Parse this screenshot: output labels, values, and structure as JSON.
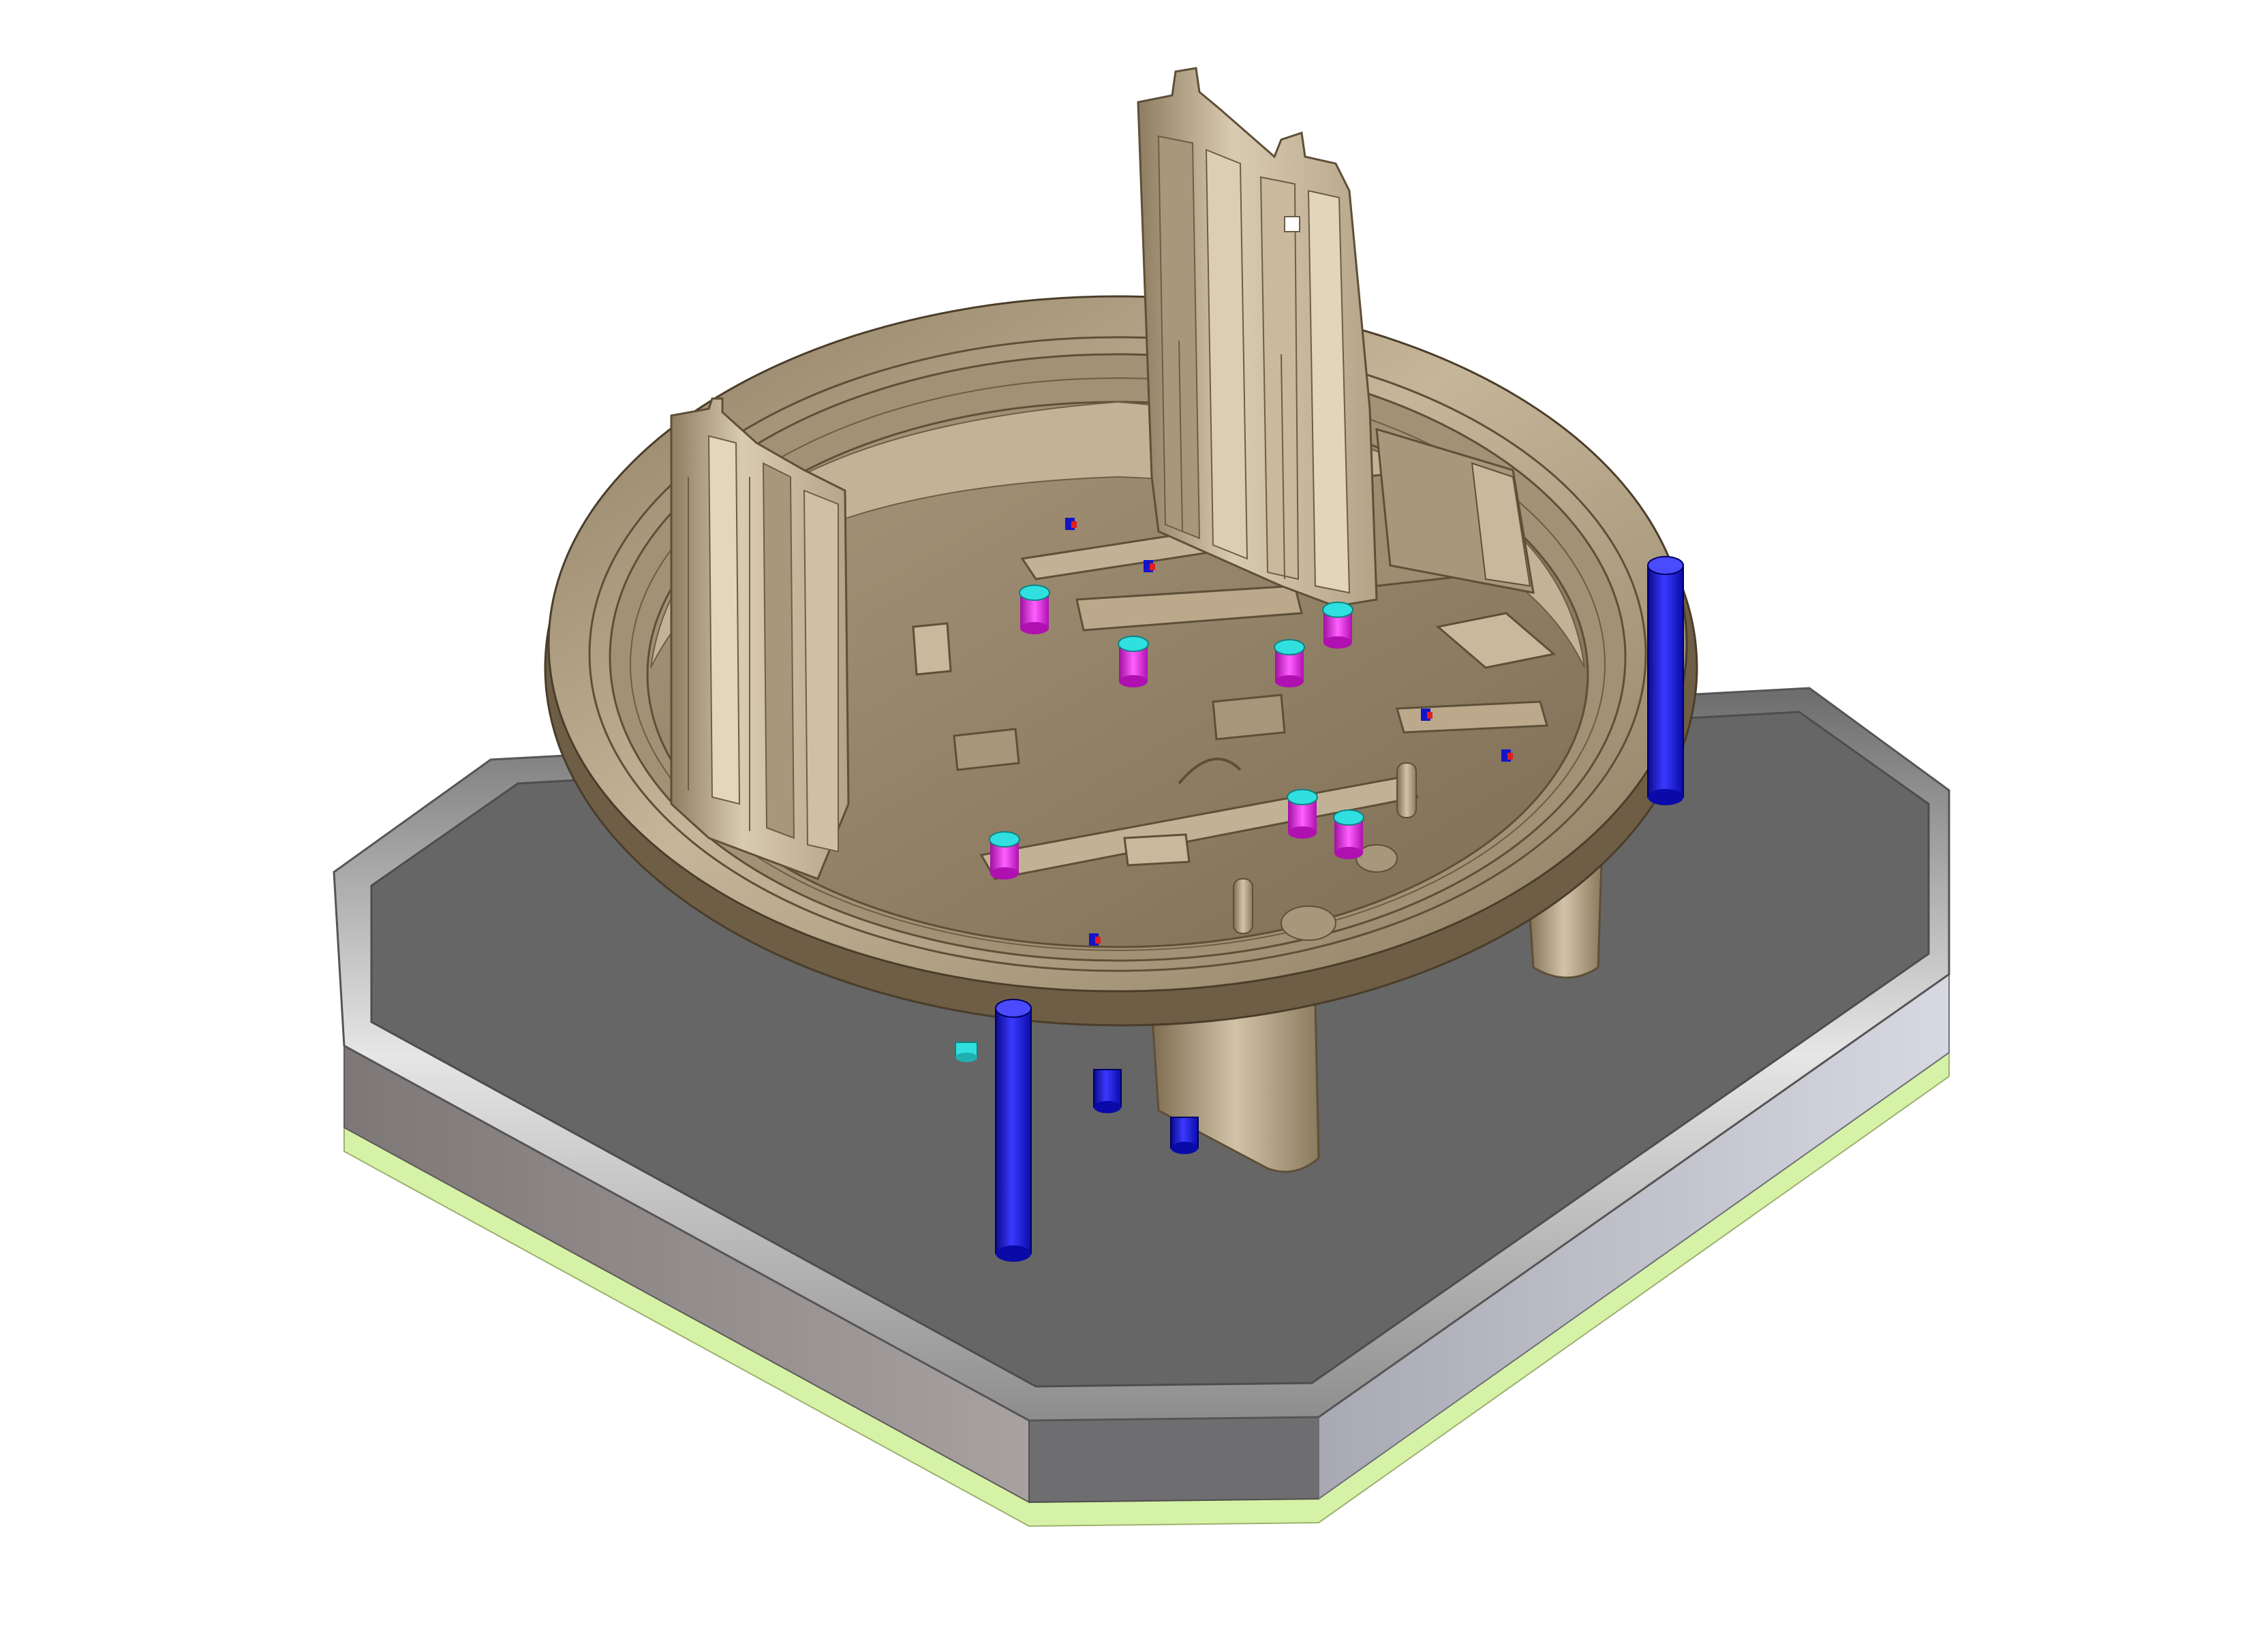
{
  "viewport": {
    "background": "#ffffff"
  },
  "colors": {
    "base_top": "#666666",
    "base_side_left": "#9c9696",
    "base_side_right": "#c7c7d3",
    "base_bevel": "#b8b8b8",
    "base_bottom_band": "#d9f5a8",
    "part_tan": "#b8a78d",
    "part_tan_light": "#d6c8ae",
    "part_tan_dark": "#7a6a52",
    "part_tan_shadow": "#8f7e63",
    "pin_blue": "#1414c8",
    "pin_blue_highlight": "#4a4aff",
    "ejector_magenta": "#e020e0",
    "ejector_cyan": "#30e0e0",
    "marker_red": "#e02020"
  },
  "icons": {
    "scene": "cad-mold-3d-view-icon"
  }
}
